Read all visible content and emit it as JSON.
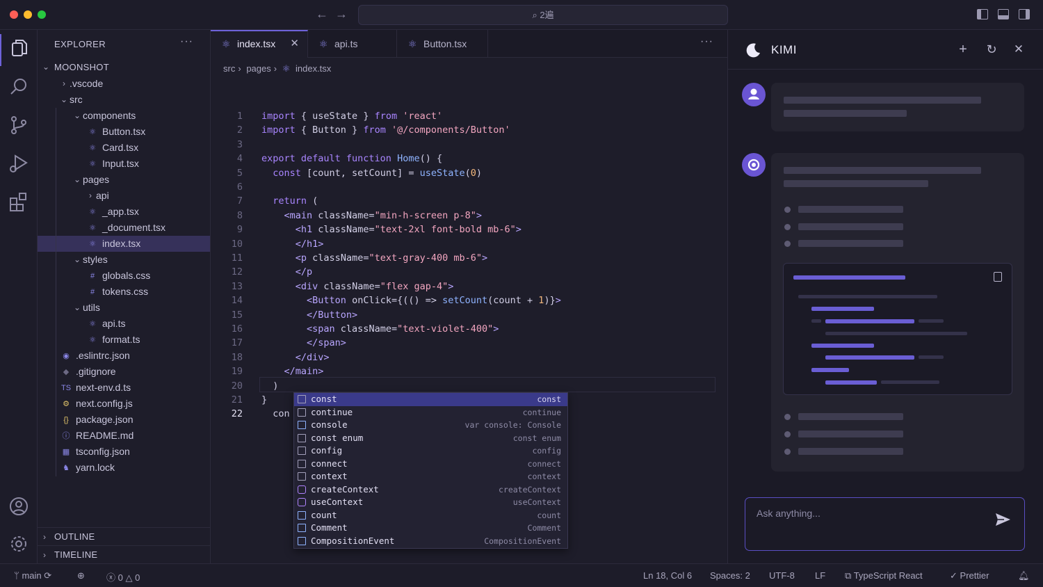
{
  "titlebar": {
    "command_center": "⌕ 2遍"
  },
  "explorer": {
    "title": "EXPLORER",
    "root": "MOONSHOT",
    "items": [
      {
        "label": ".vscode",
        "depth": 1,
        "type": "folder",
        "open": false
      },
      {
        "label": "src",
        "depth": 1,
        "type": "folder",
        "open": true
      },
      {
        "label": "components",
        "depth": 2,
        "type": "folder",
        "open": true
      },
      {
        "label": "Button.tsx",
        "depth": 3,
        "type": "react"
      },
      {
        "label": "Card.tsx",
        "depth": 3,
        "type": "react"
      },
      {
        "label": "Input.tsx",
        "depth": 3,
        "type": "react"
      },
      {
        "label": "pages",
        "depth": 2,
        "type": "folder",
        "open": true
      },
      {
        "label": "api",
        "depth": 3,
        "type": "folder",
        "open": false
      },
      {
        "label": "_app.tsx",
        "depth": 3,
        "type": "react"
      },
      {
        "label": "_document.tsx",
        "depth": 3,
        "type": "react"
      },
      {
        "label": "index.tsx",
        "depth": 3,
        "type": "react",
        "selected": true
      },
      {
        "label": "styles",
        "depth": 2,
        "type": "folder",
        "open": true
      },
      {
        "label": "globals.css",
        "depth": 3,
        "type": "css"
      },
      {
        "label": "tokens.css",
        "depth": 3,
        "type": "css"
      },
      {
        "label": "utils",
        "depth": 2,
        "type": "folder",
        "open": true
      },
      {
        "label": "api.ts",
        "depth": 3,
        "type": "react"
      },
      {
        "label": "format.ts",
        "depth": 3,
        "type": "react"
      },
      {
        "label": ".eslintrc.json",
        "depth": 1,
        "type": "eslint"
      },
      {
        "label": ".gitignore",
        "depth": 1,
        "type": "git"
      },
      {
        "label": "next-env.d.ts",
        "depth": 1,
        "type": "ts"
      },
      {
        "label": "next.config.js",
        "depth": 1,
        "type": "js"
      },
      {
        "label": "package.json",
        "depth": 1,
        "type": "json"
      },
      {
        "label": "README.md",
        "depth": 1,
        "type": "info"
      },
      {
        "label": "tsconfig.json",
        "depth": 1,
        "type": "tsconfig"
      },
      {
        "label": "yarn.lock",
        "depth": 1,
        "type": "yarn"
      }
    ],
    "outline": "OUTLINE",
    "timeline": "TIMELINE"
  },
  "editor": {
    "tabs": [
      {
        "label": "index.tsx",
        "active": true
      },
      {
        "label": "api.ts",
        "active": false
      },
      {
        "label": "Button.tsx",
        "active": false
      }
    ],
    "breadcrumb": [
      "src",
      "pages",
      "index.tsx"
    ],
    "lines": [
      "1",
      "2",
      "3",
      "4",
      "5",
      "6",
      "7",
      "8",
      "9",
      "10",
      "11",
      "12",
      "13",
      "14",
      "15",
      "16",
      "17",
      "18",
      "19",
      "20",
      "21",
      "22"
    ],
    "current_line": "22"
  },
  "suggest": [
    {
      "label": "const",
      "detail": "const",
      "icon": "keyword",
      "selected": true
    },
    {
      "label": "continue",
      "detail": "continue",
      "icon": "keyword"
    },
    {
      "label": "console",
      "detail": "var console: Console",
      "icon": "var"
    },
    {
      "label": "const enum",
      "detail": "const enum",
      "icon": "snippet"
    },
    {
      "label": "config",
      "detail": "config",
      "icon": "snippet"
    },
    {
      "label": "connect",
      "detail": "connect",
      "icon": "snippet"
    },
    {
      "label": "context",
      "detail": "context",
      "icon": "snippet"
    },
    {
      "label": "createContext",
      "detail": "createContext",
      "icon": "cube"
    },
    {
      "label": "useContext",
      "detail": "useContext",
      "icon": "cube"
    },
    {
      "label": "count",
      "detail": "count",
      "icon": "var"
    },
    {
      "label": "Comment",
      "detail": "Comment",
      "icon": "var"
    },
    {
      "label": "CompositionEvent",
      "detail": "CompositionEvent",
      "icon": "var"
    }
  ],
  "kimi": {
    "title": "KIMI",
    "ask_placeholder": "Ask anything..."
  },
  "status": {
    "branch": "main",
    "errors": "0",
    "warnings": "0",
    "position": "Ln 18, Col 6",
    "spaces": "Spaces: 2",
    "encoding": "UTF-8",
    "eol": "LF",
    "language": "TypeScript React",
    "formatter": "Prettier"
  },
  "colors": {
    "accent": "#6e62d9",
    "selection": "#36315a",
    "suggest_selected": "#3a3a8a"
  }
}
